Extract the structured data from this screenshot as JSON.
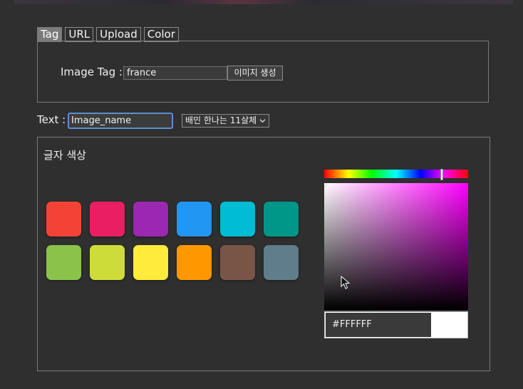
{
  "tabs": [
    {
      "label": "Tag",
      "active": true
    },
    {
      "label": "URL",
      "active": false
    },
    {
      "label": "Upload",
      "active": false
    },
    {
      "label": "Color",
      "active": false
    }
  ],
  "tag_panel": {
    "label": "Image Tag :",
    "input_value": "france",
    "generate_button": "이미지 생성"
  },
  "text_row": {
    "label": "Text :",
    "input_value": "Image_name",
    "font_select": "배민 한나는 11살체",
    "font_select_icon": "chevron-down-icon"
  },
  "color_panel": {
    "title": "글자 색상",
    "swatches": [
      "#f44336",
      "#e91e63",
      "#9c27b0",
      "#2196f3",
      "#00bcd4",
      "#009688",
      "#8bc34a",
      "#cddc39",
      "#ffeb3b",
      "#ff9800",
      "#795548",
      "#607d8b"
    ],
    "picker": {
      "hue_color": "#ff00ff",
      "hex_value": "#FFFFFF",
      "preview_color": "#ffffff"
    }
  }
}
